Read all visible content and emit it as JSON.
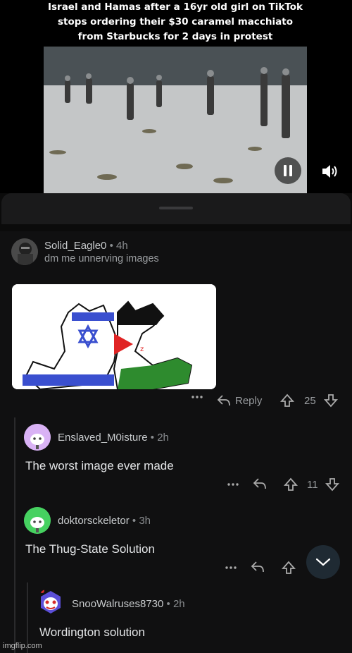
{
  "video": {
    "caption": "Israel and Hamas after a 16yr old girl on TikTok stops ordering their $30 caramel macchiato from Starbucks for 2 days in protest"
  },
  "post": {
    "username": "Solid_Eagle0",
    "time": "4h",
    "flair": "dm me unnerving images",
    "reply_label": "Reply",
    "votes": "25"
  },
  "replies": [
    {
      "username": "Enslaved_M0isture",
      "time": "2h",
      "text": "The worst image ever made",
      "votes": "11"
    },
    {
      "username": "doktorsckeletor",
      "time": "3h",
      "text": "The Thug-State Solution",
      "votes": ""
    },
    {
      "username": "SnooWalruses8730",
      "time": "2h",
      "text": "Wordington solution"
    }
  ],
  "separator": "•",
  "watermark": "imgflip.com",
  "colors": {
    "background": "#0b0b0b",
    "text": "#d7dadc",
    "muted": "#8a8d90",
    "fab": "#1f2a33"
  }
}
